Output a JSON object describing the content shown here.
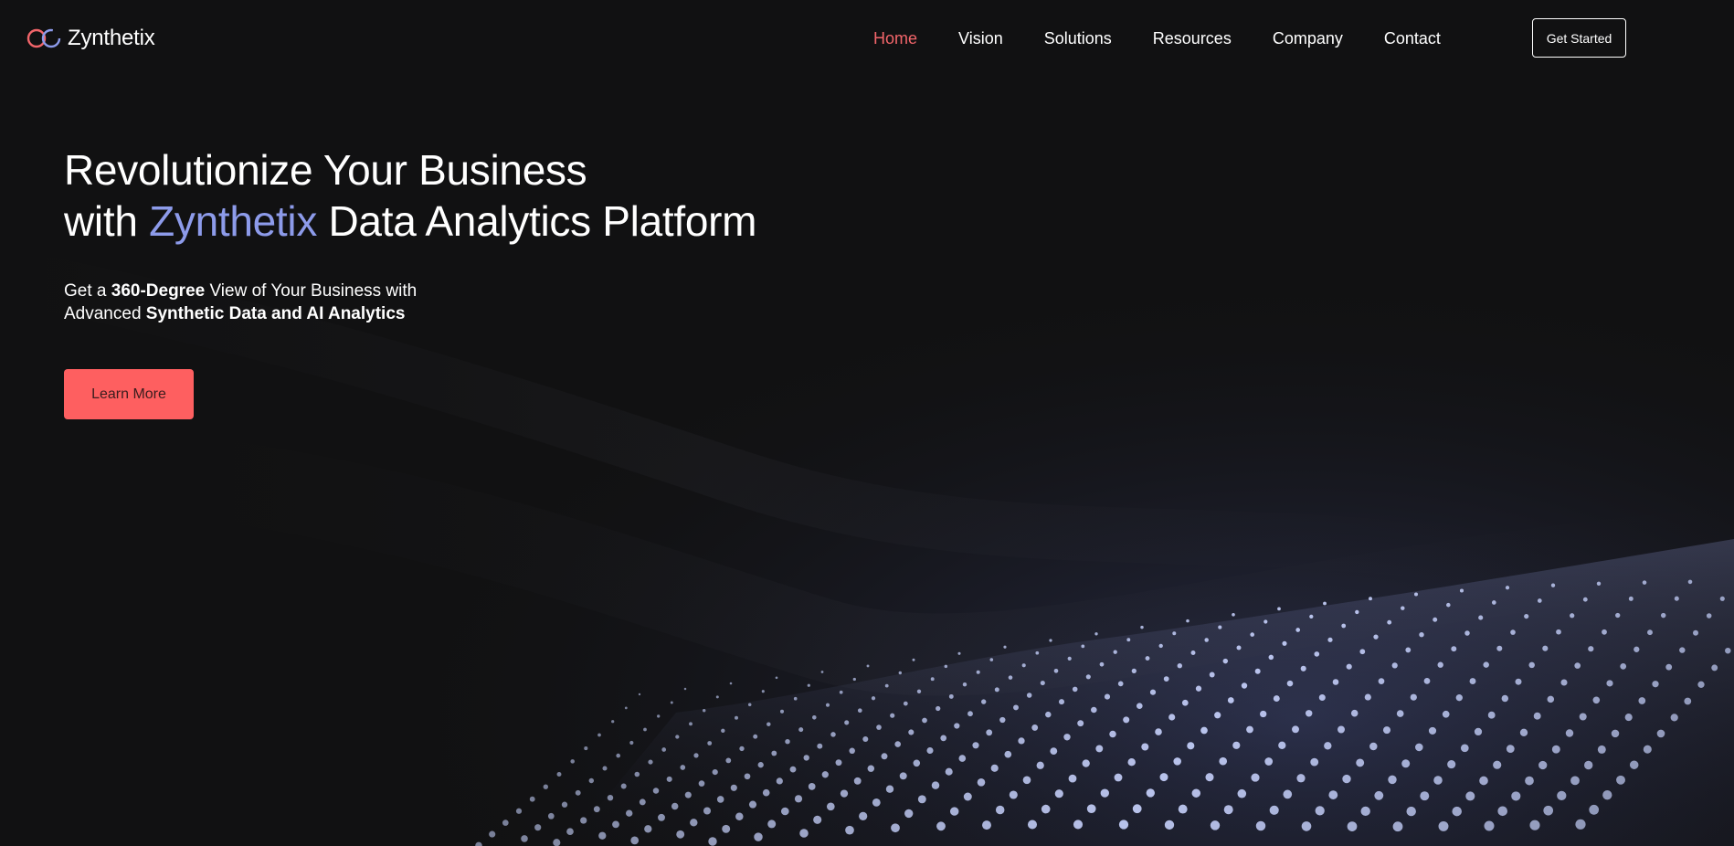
{
  "brand": {
    "name": "Zynthetix",
    "logo_icon": "infinity-loop-icon",
    "logo_colors": [
      "#f2656a",
      "#8d9bea"
    ]
  },
  "nav": {
    "items": [
      {
        "label": "Home",
        "active": true
      },
      {
        "label": "Vision",
        "active": false
      },
      {
        "label": "Solutions",
        "active": false
      },
      {
        "label": "Resources",
        "active": false
      },
      {
        "label": "Company",
        "active": false
      },
      {
        "label": "Contact",
        "active": false
      }
    ],
    "cta_label": "Get Started"
  },
  "hero": {
    "title_line1": "Revolutionize Your Business",
    "title_line2_prefix": "with ",
    "title_line2_accent": "Zynthetix",
    "title_line2_suffix": " Data Analytics Platform",
    "subtitle": {
      "part1": "Get a ",
      "bold1": "360-Degree",
      "part2": " View of Your Business with",
      "part3": "Advanced ",
      "bold2": "Synthetic Data and AI Analytics"
    },
    "button_label": "Learn More"
  },
  "colors": {
    "background": "#111112",
    "accent": "#f2656a",
    "brand_accent": "#8d9bea",
    "button": "#fe5f60",
    "particles": "#c9d4ff"
  }
}
